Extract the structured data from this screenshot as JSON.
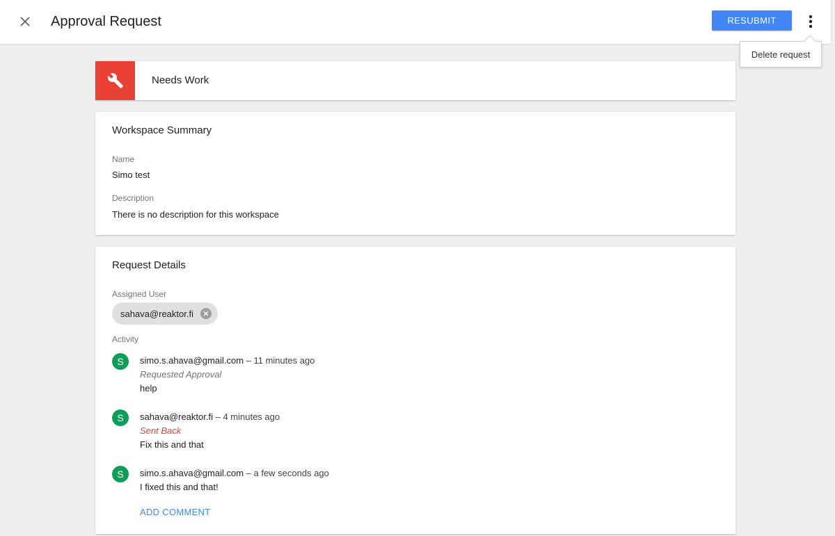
{
  "header": {
    "title": "Approval Request",
    "resubmit_label": "RESUBMIT"
  },
  "menu": {
    "delete_label": "Delete request"
  },
  "status": {
    "label": "Needs Work",
    "color": "#e94235"
  },
  "summary": {
    "title": "Workspace Summary",
    "name_label": "Name",
    "name_value": "Simo test",
    "description_label": "Description",
    "description_value": "There is no description for this workspace"
  },
  "details": {
    "title": "Request Details",
    "assigned_label": "Assigned User",
    "assigned_user": "sahava@reaktor.fi",
    "activity_label": "Activity",
    "activities": [
      {
        "avatar": "S",
        "user": "simo.s.ahava@gmail.com",
        "time": " – 11 minutes ago",
        "status": "Requested Approval",
        "message": "help"
      },
      {
        "avatar": "S",
        "user": "sahava@reaktor.fi",
        "time": " – 4 minutes ago",
        "status": "Sent Back",
        "message": "Fix this and that"
      },
      {
        "avatar": "S",
        "user": "simo.s.ahava@gmail.com",
        "time": " – a few seconds ago",
        "message": "I fixed this and that!"
      }
    ],
    "add_comment_label": "ADD COMMENT"
  },
  "colors": {
    "accent": "#4285f4",
    "avatar": "#0f9d58",
    "sent_back": "#db4437"
  },
  "icons": {
    "close": "close-icon",
    "more": "more-vert-icon",
    "status": "wrench-icon",
    "chip_remove": "cancel-icon"
  }
}
